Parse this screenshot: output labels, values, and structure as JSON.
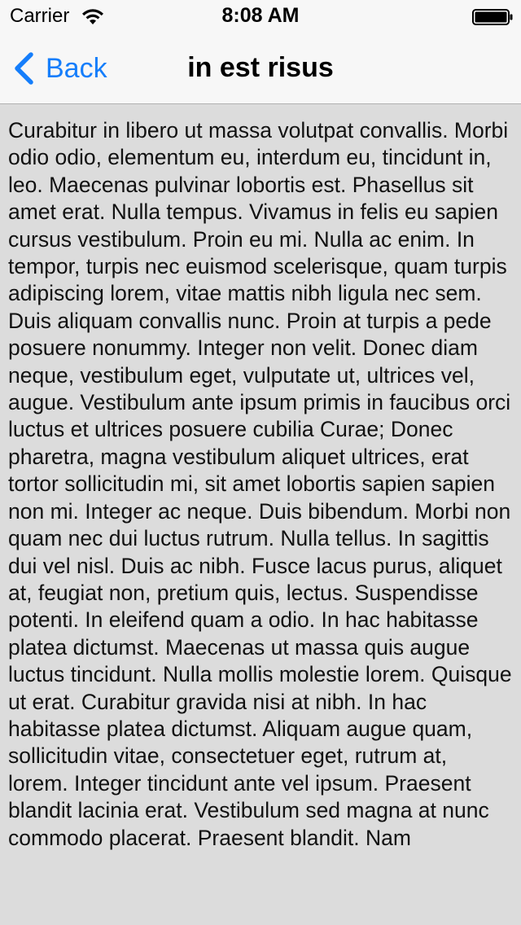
{
  "status_bar": {
    "carrier": "Carrier",
    "time": "8:08 AM",
    "wifi_icon": "wifi-icon",
    "battery_icon": "battery-icon"
  },
  "nav": {
    "back_label": "Back",
    "back_icon": "chevron-left-icon",
    "title": "in est risus",
    "tint_color": "#157efb"
  },
  "content": {
    "text": "Curabitur in libero ut massa volutpat convallis. Morbi odio odio, elementum eu, interdum eu, tincidunt in, leo. Maecenas pulvinar lobortis est. Phasellus sit amet erat. Nulla tempus. Vivamus in felis eu sapien cursus vestibulum. Proin eu mi. Nulla ac enim. In tempor, turpis nec euismod scelerisque, quam turpis adipiscing lorem, vitae mattis nibh ligula nec sem. Duis aliquam convallis nunc. Proin at turpis a pede posuere nonummy. Integer non velit. Donec diam neque, vestibulum eget, vulputate ut, ultrices vel, augue. Vestibulum ante ipsum primis in faucibus orci luctus et ultrices posuere cubilia Curae; Donec pharetra, magna vestibulum aliquet ultrices, erat tortor sollicitudin mi, sit amet lobortis sapien sapien non mi. Integer ac neque. Duis bibendum. Morbi non quam nec dui luctus rutrum. Nulla tellus. In sagittis dui vel nisl. Duis ac nibh. Fusce lacus purus, aliquet at, feugiat non, pretium quis, lectus. Suspendisse potenti. In eleifend quam a odio. In hac habitasse platea dictumst. Maecenas ut massa quis augue luctus tincidunt. Nulla mollis molestie lorem. Quisque ut erat. Curabitur gravida nisi at nibh. In hac habitasse platea dictumst. Aliquam augue quam, sollicitudin vitae, consectetuer eget, rutrum at, lorem. Integer tincidunt ante vel ipsum. Praesent blandit lacinia erat. Vestibulum sed magna at nunc commodo placerat. Praesent blandit. Nam",
    "background_color": "#dcdcdc"
  }
}
